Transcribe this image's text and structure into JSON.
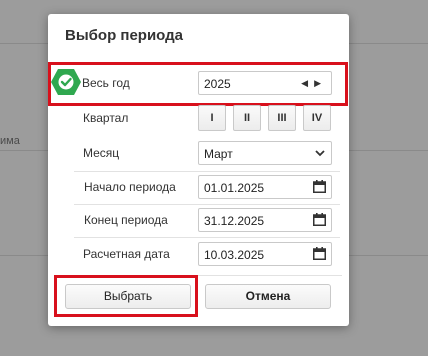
{
  "background": {
    "partial_label": "има"
  },
  "dialog": {
    "title": "Выбор периода",
    "whole_year": {
      "label": "Весь год",
      "value": "2025",
      "checked": true
    },
    "quarter": {
      "label": "Квартал",
      "options": [
        "I",
        "II",
        "III",
        "IV"
      ]
    },
    "month": {
      "label": "Месяц",
      "value": "Март"
    },
    "period_start": {
      "label": "Начало периода",
      "value": "01.01.2025"
    },
    "period_end": {
      "label": "Конец периода",
      "value": "31.12.2025"
    },
    "calc_date": {
      "label": "Расчетная дата",
      "value": "10.03.2025"
    },
    "select_button": "Выбрать",
    "cancel_button": "Отмена"
  },
  "colors": {
    "highlight": "#d8101c",
    "check_marker": "#2fa84f"
  },
  "icons": {
    "year_arrows": "triangle-left-right-icon",
    "month_dropdown": "chevron-down-icon",
    "date_picker": "calendar-icon",
    "checked": "check-icon"
  }
}
